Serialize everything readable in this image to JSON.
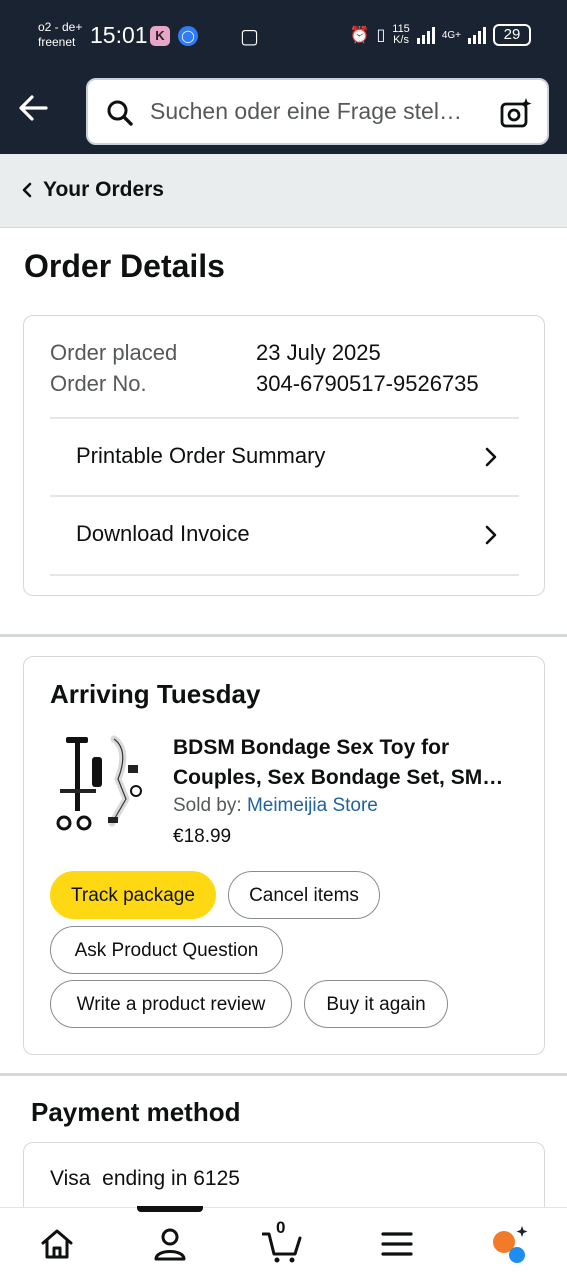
{
  "status_bar": {
    "carrier_line1": "o2 - de+",
    "carrier_line2": "freenet",
    "time": "15:01",
    "app_badge": "K",
    "speed_value": "115",
    "speed_unit": "K/s",
    "network": "4G+",
    "battery": "29"
  },
  "header": {
    "search_placeholder": "Suchen oder eine Frage stel…"
  },
  "breadcrumb": {
    "label": "Your Orders"
  },
  "page": {
    "title": "Order Details"
  },
  "order": {
    "placed_label": "Order placed",
    "placed_value": "23 July 2025",
    "number_label": "Order No.",
    "number_value": "304-6790517-9526735",
    "links": [
      {
        "label": "Printable Order Summary"
      },
      {
        "label": "Download Invoice"
      }
    ]
  },
  "shipment": {
    "status": "Arriving Tuesday",
    "product": {
      "title_line1": "BDSM Bondage Sex Toy for",
      "title_line2": "Couples, Sex Bondage Set, SM…",
      "sold_by_label": "Sold by:",
      "seller": "Meimeijia Store",
      "price": "€18.99"
    },
    "actions": {
      "track": "Track package",
      "cancel": "Cancel items",
      "ask": "Ask Product Question",
      "review": "Write a product review",
      "buy_again": "Buy it again"
    }
  },
  "payment": {
    "title": "Payment method",
    "method": "Visa  ending in 6125"
  },
  "bottom_nav": {
    "cart_count": "0"
  },
  "colors": {
    "header_bg": "#1a2332",
    "primary_button": "#ffd814",
    "link": "#2162a1",
    "rufus_orange": "#f27b2a",
    "rufus_blue": "#1f8cf0"
  }
}
